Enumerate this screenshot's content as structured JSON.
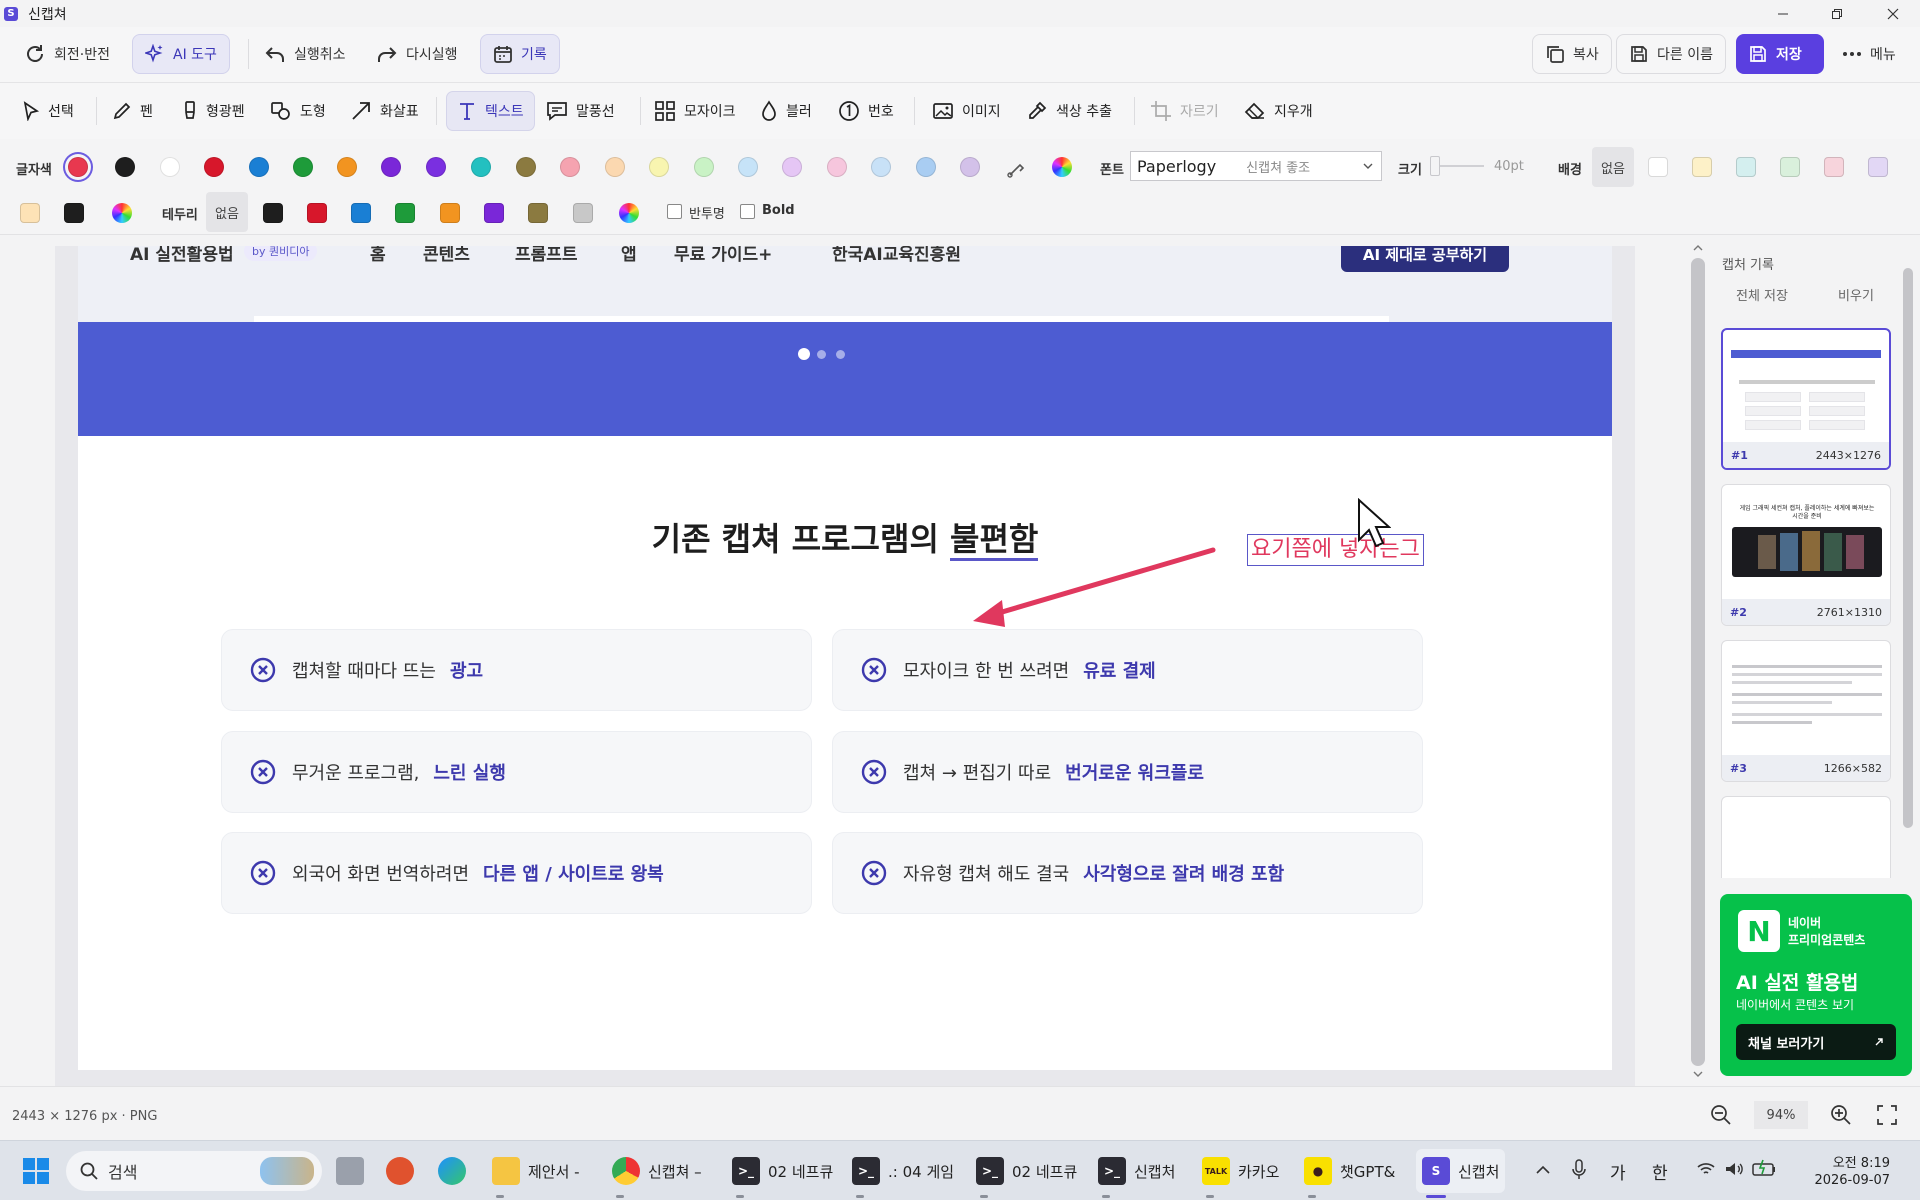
{
  "window": {
    "title": "신캡쳐"
  },
  "toolbar_top": {
    "rotate": "회전·반전",
    "ai": "AI 도구",
    "undo": "실행취소",
    "redo": "다시실행",
    "history": "기록",
    "copy": "복사",
    "save_as": "다른 이름",
    "save": "저장",
    "menu": "메뉴"
  },
  "tools": {
    "select": "선택",
    "pen": "펜",
    "highlighter": "형광펜",
    "shape": "도형",
    "arrow": "화살표",
    "text": "텍스트",
    "balloon": "말풍선",
    "mosaic": "모자이크",
    "blur": "블러",
    "number": "번호",
    "image": "이미지",
    "color_pick": "색상 추출",
    "crop": "자르기",
    "eraser": "지우개"
  },
  "text_options": {
    "font_color_label": "글자색",
    "font_label": "폰트",
    "font_value": "Paperlogy",
    "font_hint": "신캡쳐 좋조",
    "size_label": "크기",
    "size_value": "40pt",
    "bg_label": "배경",
    "bg_none": "없음",
    "border_label": "테두리",
    "border_none": "없음",
    "semi_transparent": "반투명",
    "bold": "Bold",
    "font_colors": [
      "#e8384f",
      "#1e1e1e",
      "#ffffff",
      "#d7172b",
      "#1a7fd4",
      "#1e9b3a",
      "#f29420",
      "#7a27d8",
      "#7a2fe0",
      "#23c0c0",
      "#8b7a40",
      "#f5a3b0",
      "#fbd8b0",
      "#f8f5b0",
      "#c9f2c5",
      "#c6e3f8",
      "#e5c6f5",
      "#f6c6dd",
      "#c8e1f7",
      "#a9cdf2",
      "#d3c1e9"
    ],
    "bg_colors": [
      "#ffffff",
      "#fdf1c8",
      "#d4efef",
      "#d9f0dc",
      "#f7d4dc",
      "#e2d7f5",
      "#fde2b6",
      "#1e1e1e"
    ],
    "border_colors": [
      "#1e1e1e",
      "#d7172b",
      "#1a7fd4",
      "#1e9b3a",
      "#f29420",
      "#7a27d8",
      "#8b7a40",
      "#c8c8c8"
    ]
  },
  "capture": {
    "nav": {
      "brand": "AI 실전활용법",
      "brand_tag": "by 퀀비디아",
      "items": [
        "홈",
        "콘텐츠",
        "프롬프트",
        "앱",
        "무료 가이드+",
        "한국AI교육진흥원"
      ],
      "cta": "AI 제대로 공부하기"
    },
    "title_prefix": "기존 캡쳐 프로그램의 ",
    "title_em": "불편함",
    "annotation": "요기쯤에 넣자는그",
    "cards": [
      {
        "text": "캡쳐할 때마다 뜨는",
        "em": "광고"
      },
      {
        "text": "모자이크 한 번 쓰려면",
        "em": "유료 결제"
      },
      {
        "text": "무거운 프로그램,",
        "em": "느린 실행"
      },
      {
        "text": "캡쳐 → 편집기 따로",
        "em": "번거로운 워크플로"
      },
      {
        "text": "외국어 화면 번역하려면",
        "em": "다른 앱 / 사이트로 왕복"
      },
      {
        "text": "자유형 캡쳐 해도 결국",
        "em": "사각형으로 잘려 배경 포함"
      }
    ]
  },
  "history_panel": {
    "title": "캡처 기록",
    "save_all": "전체 저장",
    "clear": "비우기",
    "items": [
      {
        "num": "#1",
        "size": "2443×1276"
      },
      {
        "num": "#2",
        "size": "2761×1310"
      },
      {
        "num": "#3",
        "size": "1266×582"
      }
    ],
    "thumb2_caption": "게임 그래픽 세컨쳐 캡처, 플레이하는 세계에 빠져보는 시간을 준비"
  },
  "ad": {
    "logo": "N",
    "brand_line1": "네이버",
    "brand_line2": "프리미엄콘텐츠",
    "headline": "AI 실전 활용법",
    "sub": "네이버에서 콘텐츠 보기",
    "button": "채널 보러가기"
  },
  "status": {
    "info": "2443 × 1276 px · PNG",
    "zoom": "94%"
  },
  "taskbar": {
    "search": "검색",
    "apps": [
      {
        "label": "제안서 -",
        "icon": "folder-icon"
      },
      {
        "label": "신캡쳐 –",
        "icon": "chrome-icon"
      },
      {
        "label": "02 네프큐",
        "icon": "terminal-icon"
      },
      {
        "label": ".: 04 게임",
        "icon": "terminal-icon"
      },
      {
        "label": "02 네프큐",
        "icon": "terminal-icon"
      },
      {
        "label": "신캡처",
        "icon": "terminal-icon"
      },
      {
        "label": "카카오",
        "icon": "kakaotalk-icon"
      },
      {
        "label": "챗GPT&",
        "icon": "chat-icon"
      },
      {
        "label": "신캡처",
        "icon": "app-icon"
      }
    ],
    "ime1": "가",
    "ime2": "한",
    "time": "오전 8:19",
    "date": "2026-09-07"
  },
  "colors": {
    "accent": "#5a3fe0",
    "banner": "#4d5cd2",
    "annotation": "#e0385e",
    "emphasis": "#3d39ad",
    "naver": "#06c14a"
  }
}
